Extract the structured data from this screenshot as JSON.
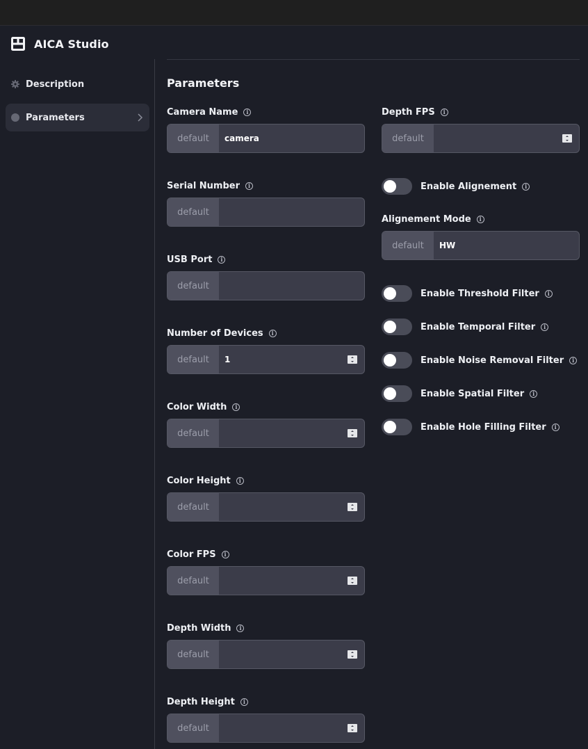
{
  "app": {
    "title": "AICA Studio",
    "icon": "layout-grid-icon"
  },
  "sidebar": {
    "items": [
      {
        "label": "Description",
        "icon": "gear-icon",
        "active": false
      },
      {
        "label": "Parameters",
        "icon": "circle-dot-icon",
        "active": true
      }
    ]
  },
  "main": {
    "title": "Parameters",
    "default_label": "default",
    "fields_left": [
      {
        "label": "Camera Name",
        "value": "camera",
        "numeric": false
      },
      {
        "label": "Serial Number",
        "value": "",
        "numeric": false
      },
      {
        "label": "USB Port",
        "value": "",
        "numeric": false
      },
      {
        "label": "Number of Devices",
        "value": "1",
        "numeric": true
      },
      {
        "label": "Color Width",
        "value": "",
        "numeric": true
      },
      {
        "label": "Color Height",
        "value": "",
        "numeric": true
      },
      {
        "label": "Color FPS",
        "value": "",
        "numeric": true
      },
      {
        "label": "Depth Width",
        "value": "",
        "numeric": true
      },
      {
        "label": "Depth Height",
        "value": "",
        "numeric": true
      }
    ],
    "depth_fps": {
      "label": "Depth FPS",
      "value": "",
      "numeric": true
    },
    "enable_alignment": {
      "label": "Enable Alignement",
      "enabled": false
    },
    "alignment_mode": {
      "label": "Alignement Mode",
      "value": "HW"
    },
    "filters": [
      {
        "label": "Enable Threshold Filter",
        "enabled": false
      },
      {
        "label": "Enable Temporal Filter",
        "enabled": false
      },
      {
        "label": "Enable Noise Removal Filter",
        "enabled": false
      },
      {
        "label": "Enable Spatial Filter",
        "enabled": false
      },
      {
        "label": "Enable Hole Filling Filter",
        "enabled": false
      }
    ]
  },
  "colors": {
    "background": "#1c1e27",
    "field": "#3b3c49",
    "field_prefix": "#4f505e",
    "toggle_off": "#4a4c58"
  }
}
